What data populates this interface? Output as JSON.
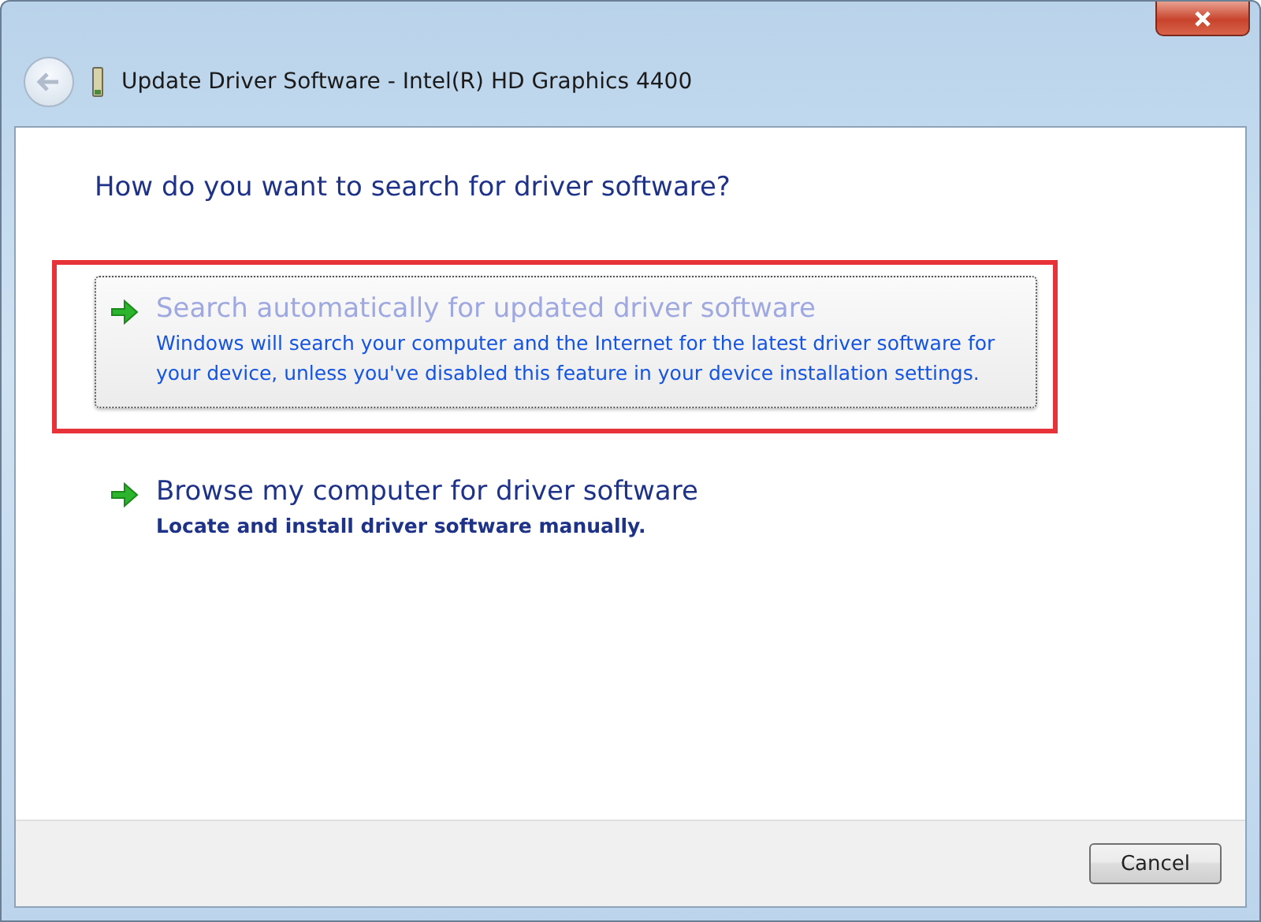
{
  "window": {
    "title": "Update Driver Software - Intel(R) HD Graphics 4400"
  },
  "heading": "How do you want to search for driver software?",
  "options": [
    {
      "title": "Search automatically for updated driver software",
      "description": "Windows will search your computer and the Internet for the latest driver software for your device, unless you've disabled this feature in your device installation settings.",
      "selected": true,
      "annotated": true
    },
    {
      "title": "Browse my computer for driver software",
      "description": "Locate and install driver software manually.",
      "selected": false,
      "annotated": false
    }
  ],
  "buttons": [
    {
      "label": "Cancel"
    }
  ]
}
